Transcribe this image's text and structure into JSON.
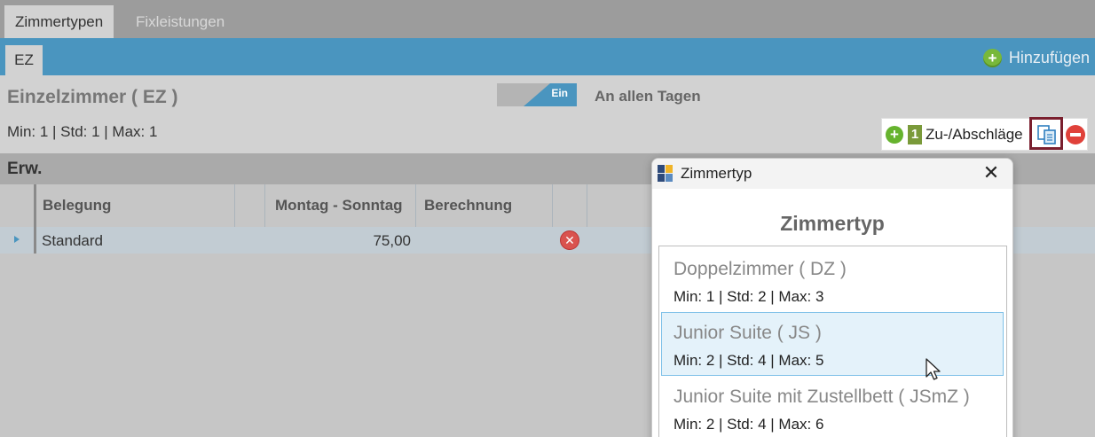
{
  "top_tabs": [
    "Zimmertypen",
    "Fixleistungen"
  ],
  "sub_tab": "EZ",
  "add_label": "Hinzufügen",
  "room": {
    "title": "Einzelzimmer  ( EZ )",
    "toggle": "Ein",
    "days": "An allen Tagen",
    "minmax": "Min:  1  |  Std:  1  |  Max:  1"
  },
  "surcharges": {
    "count": "1",
    "label": "Zu-/Abschläge"
  },
  "erw_label": "Erw.",
  "grid": {
    "columns": [
      "Belegung",
      "Montag - Sonntag",
      "Berechnung"
    ],
    "rows": [
      {
        "belegung": "Standard",
        "price": "75,00",
        "berechnung": ""
      }
    ]
  },
  "dialog": {
    "window_title": "Zimmertyp",
    "heading": "Zimmertyp",
    "items": [
      {
        "name": "Doppelzimmer  ( DZ )",
        "minmax": "Min:  1  |  Std:  2  |  Max:  3"
      },
      {
        "name": "Junior Suite  ( JS )",
        "minmax": "Min:  2  |  Std:  4  |  Max:  5"
      },
      {
        "name": "Junior Suite mit Zustellbett  ( JSmZ )",
        "minmax": "Min:  2  |  Std:  4  |  Max:  6"
      }
    ]
  },
  "colors": {
    "accent_blue": "#4a95bf",
    "selection": "#e4f2fa",
    "add_green": "#78b83a",
    "remove_red": "#e0413a"
  }
}
